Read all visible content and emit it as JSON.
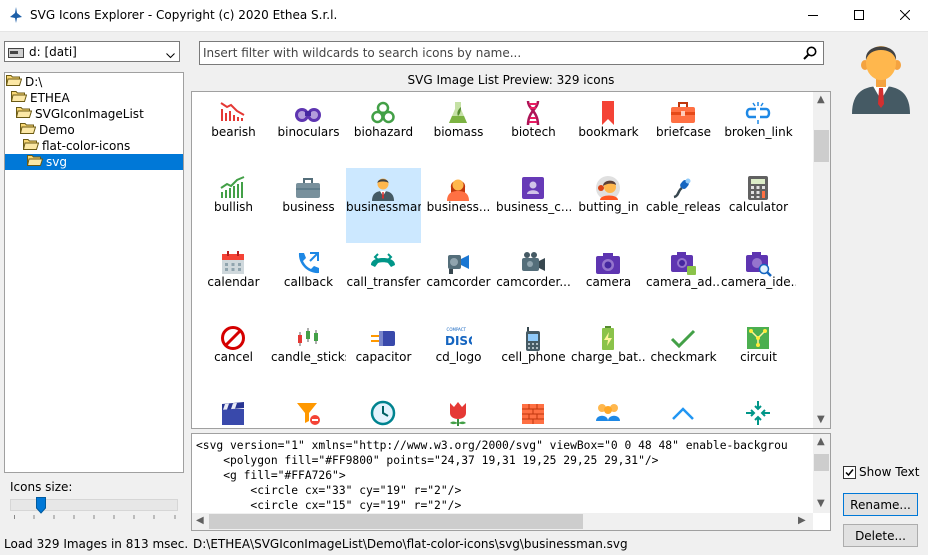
{
  "window": {
    "title": "SVG Icons Explorer - Copyright (c) 2020 Ethea S.r.l."
  },
  "drive": {
    "label": "d: [dati]"
  },
  "tree": [
    {
      "label": "D:\\",
      "level": 0,
      "selected": false
    },
    {
      "label": "ETHEA",
      "level": 1,
      "selected": false
    },
    {
      "label": "SVGIconImageList",
      "level": 2,
      "selected": false
    },
    {
      "label": "Demo",
      "level": 3,
      "selected": false
    },
    {
      "label": "flat-color-icons",
      "level": 4,
      "selected": false
    },
    {
      "label": "svg",
      "level": 5,
      "selected": true
    }
  ],
  "icons_size": {
    "label": "Icons size:"
  },
  "search": {
    "placeholder": "Insert filter with wildcards to search icons by name..."
  },
  "preview": {
    "title": "SVG Image List Preview: 329 icons"
  },
  "icons": [
    {
      "label": "bearish"
    },
    {
      "label": "binoculars"
    },
    {
      "label": "biohazard"
    },
    {
      "label": "biomass"
    },
    {
      "label": "biotech"
    },
    {
      "label": "bookmark"
    },
    {
      "label": "briefcase"
    },
    {
      "label": "broken_link"
    },
    {
      "label": "bullish"
    },
    {
      "label": "business"
    },
    {
      "label": "businessman",
      "selected": true
    },
    {
      "label": "business..."
    },
    {
      "label": "business_c..."
    },
    {
      "label": "butting_in"
    },
    {
      "label": "cable_release"
    },
    {
      "label": "calculator"
    },
    {
      "label": "calendar"
    },
    {
      "label": "callback"
    },
    {
      "label": "call_transfer"
    },
    {
      "label": "camcorder"
    },
    {
      "label": "camcorder..."
    },
    {
      "label": "camera"
    },
    {
      "label": "camera_ad..."
    },
    {
      "label": "camera_ide..."
    },
    {
      "label": "cancel"
    },
    {
      "label": "candle_sticks"
    },
    {
      "label": "capacitor"
    },
    {
      "label": "cd_logo"
    },
    {
      "label": "cell_phone"
    },
    {
      "label": "charge_bat..."
    },
    {
      "label": "checkmark"
    },
    {
      "label": "circuit"
    }
  ],
  "cd_logo_text": {
    "small": "COMPACT",
    "big": "DISC"
  },
  "code": {
    "lines": [
      "<svg version=\"1\" xmlns=\"http://www.w3.org/2000/svg\" viewBox=\"0 0 48 48\" enable-backgrou",
      "    <polygon fill=\"#FF9800\" points=\"24,37 19,31 19,25 29,25 29,31\"/>",
      "    <g fill=\"#FFA726\">",
      "        <circle cx=\"33\" cy=\"19\" r=\"2\"/>",
      "        <circle cx=\"15\" cy=\"19\" r=\"2\"/>"
    ]
  },
  "right": {
    "show_text": "Show Text",
    "show_text_checked": true,
    "rename": "Rename...",
    "delete": "Delete..."
  },
  "status": {
    "load": "Load 329 Images in 813 msec.",
    "path": "D:\\ETHEA\\SVGIconImageList\\Demo\\flat-color-icons\\svg\\businessman.svg"
  },
  "colors": {
    "selection": "#0078d7",
    "selected_cell": "#cce8ff",
    "folder": "#f8d775"
  }
}
